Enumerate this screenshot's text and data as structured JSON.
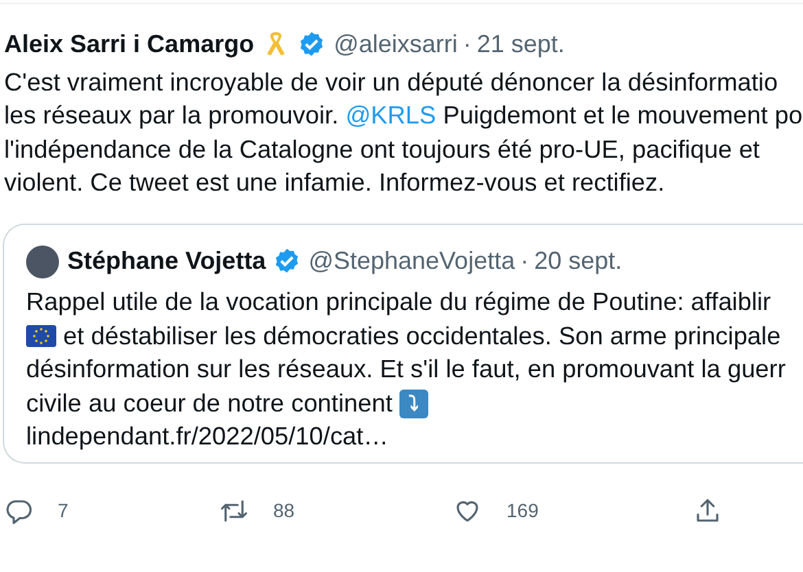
{
  "tweet": {
    "author": {
      "name": "Aleix Sarri i Camargo",
      "ribbon": true,
      "verified": true,
      "handle": "@aleixsarri",
      "separator": "·",
      "date": "21 sept."
    },
    "lines": [
      [
        {
          "kind": "text",
          "text": "C'est vraiment incroyable de voir un député dénoncer la désinformatio"
        }
      ],
      [
        {
          "kind": "text",
          "text": "les réseaux par la promouvoir. "
        },
        {
          "kind": "mention",
          "text": "@KRLS"
        },
        {
          "kind": "text",
          "text": " Puigdemont et le mouvement po"
        }
      ],
      [
        {
          "kind": "text",
          "text": "l'indépendance de la Catalogne ont toujours été pro-UE, pacifique et"
        }
      ],
      [
        {
          "kind": "text",
          "text": "violent. Ce tweet est une infamie. Informez-vous et rectifiez."
        }
      ]
    ],
    "quote": {
      "author": {
        "name": "Stéphane Vojetta",
        "verified": true,
        "handle": "@StephaneVojetta",
        "separator": "·",
        "date": "20 sept."
      },
      "lines": [
        [
          {
            "kind": "text",
            "text": "Rappel utile de la vocation principale du régime de Poutine: affaiblir"
          }
        ],
        [
          {
            "kind": "flag"
          },
          {
            "kind": "text",
            "text": " et déstabiliser les démocraties occidentales. Son arme principale"
          }
        ],
        [
          {
            "kind": "text",
            "text": "désinformation sur les réseaux. Et s'il le faut, en promouvant la guerr"
          }
        ],
        [
          {
            "kind": "text",
            "text": "civile au coeur de notre continent "
          },
          {
            "kind": "emoji",
            "text": "⤵"
          }
        ],
        [
          {
            "kind": "text",
            "text": "lindependant.fr/2022/05/10/cat…"
          }
        ]
      ]
    },
    "actions": [
      {
        "kind": "reply",
        "count": "7"
      },
      {
        "kind": "retweet",
        "count": "88"
      },
      {
        "kind": "like",
        "count": "169"
      },
      {
        "kind": "share"
      }
    ]
  }
}
